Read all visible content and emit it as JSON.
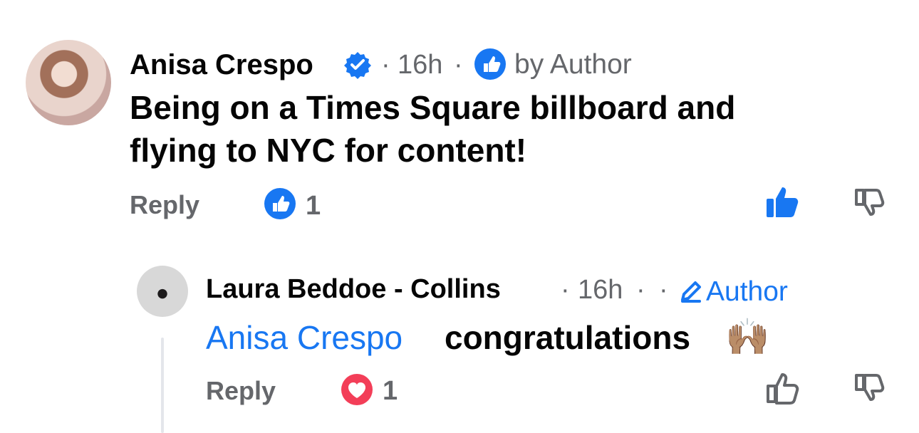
{
  "comments": [
    {
      "name": "Anisa Crespo",
      "verified_icon": "verified-badge-icon",
      "time": "16h",
      "badge_text": "by Author",
      "text_lines": [
        "Being on a Times Square billboard and",
        "flying to NYC for content!"
      ],
      "reply_label": "Reply",
      "reaction_count": "1",
      "reaction_icon": "like-reaction-icon"
    },
    {
      "name": "Laura Beddoe - Collins",
      "time": "16h",
      "author_label": "Author",
      "mention": "Anisa Crespo",
      "text": "congratulations",
      "emoji": "🙌🏽",
      "reply_label": "Reply",
      "reaction_count": "1",
      "reaction_icon": "heart-reaction-icon"
    }
  ],
  "colors": {
    "blue": "#1877f2",
    "gray": "#65676b",
    "dark": "#050505",
    "heart_red": "#f33e58"
  }
}
